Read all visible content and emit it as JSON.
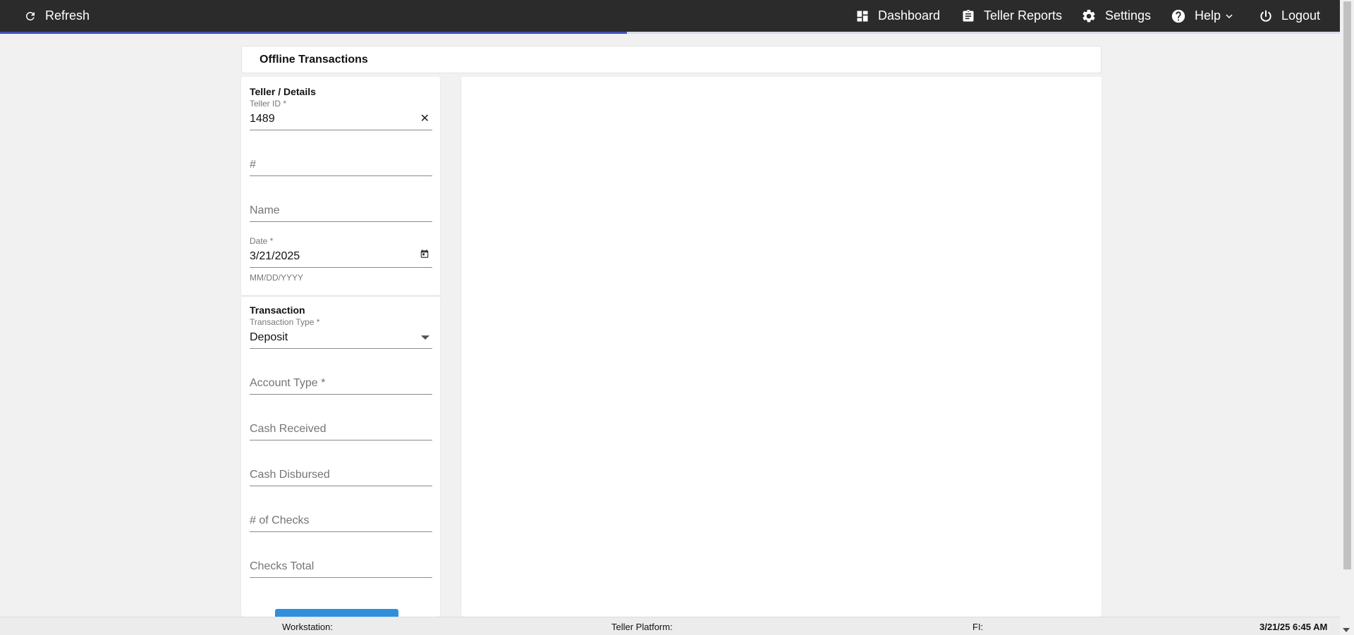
{
  "topbar": {
    "refresh_label": "Refresh",
    "dashboard_label": "Dashboard",
    "teller_reports_label": "Teller Reports",
    "settings_label": "Settings",
    "help_label": "Help",
    "logout_label": "Logout",
    "progress_percent": 46.8
  },
  "header": {
    "title": "Offline Transactions"
  },
  "teller_details": {
    "title": "Teller / Details",
    "teller_id_label": "Teller ID *",
    "teller_id_value": "1489",
    "number_placeholder": "#",
    "name_placeholder": "Name",
    "date_label": "Date *",
    "date_value": "3/21/2025",
    "date_helper": "MM/DD/YYYY"
  },
  "transaction": {
    "title": "Transaction",
    "type_label": "Transaction Type *",
    "type_value": "Deposit",
    "account_type_placeholder": "Account Type *",
    "cash_received_placeholder": "Cash Received",
    "cash_disbursed_placeholder": "Cash Disbursed",
    "num_checks_placeholder": "# of Checks",
    "checks_total_placeholder": "Checks Total"
  },
  "footer": {
    "workstation_label": "Workstation:",
    "teller_platform_label": "Teller Platform:",
    "fi_label": "FI:",
    "datetime": "3/21/25 6:45 AM"
  },
  "colors": {
    "topbar": "#2b2b2b",
    "progress": "#3f51b5",
    "button": "#2f8fdd"
  }
}
